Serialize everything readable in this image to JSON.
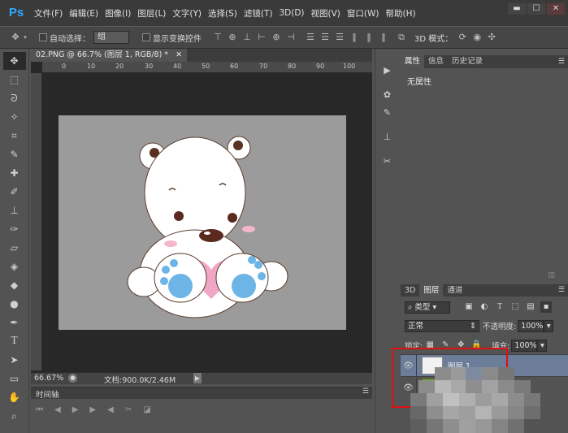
{
  "menubar": {
    "logo": "Ps",
    "items": [
      "文件(F)",
      "编辑(E)",
      "图像(I)",
      "图层(L)",
      "文字(Y)",
      "选择(S)",
      "滤镜(T)",
      "3D(D)",
      "视图(V)",
      "窗口(W)",
      "帮助(H)"
    ]
  },
  "options": {
    "auto_select_label": "自动选择：",
    "auto_select_value": "组",
    "show_transform_label": "显示变换控件",
    "mode_3d_label": "3D 模式："
  },
  "document": {
    "tab_title": "02.PNG @ 66.7% (图层 1, RGB/8) *",
    "ruler_ticks": [
      "0",
      "10",
      "20",
      "30",
      "40",
      "50",
      "60",
      "70",
      "80",
      "90",
      "100"
    ],
    "zoom": "66.67%",
    "doc_size": "文档:900.0K/2.46M"
  },
  "timeline": {
    "tab_label": "时间轴"
  },
  "properties": {
    "tabs": [
      "属性",
      "信息",
      "历史记录"
    ],
    "content": "无属性"
  },
  "layers": {
    "tabs": [
      "3D",
      "图层",
      "通道"
    ],
    "filter_label": "类型",
    "blend_mode": "正常",
    "opacity_label": "不透明度:",
    "opacity_value": "100%",
    "lock_label": "锁定:",
    "fill_label": "填充:",
    "fill_value": "100%",
    "items": [
      {
        "name": "图层 1"
      }
    ]
  },
  "colors": {
    "accent": "#31a8ff",
    "selected_layer": "#6b7d99",
    "highlight_box": "#e10f0f"
  }
}
